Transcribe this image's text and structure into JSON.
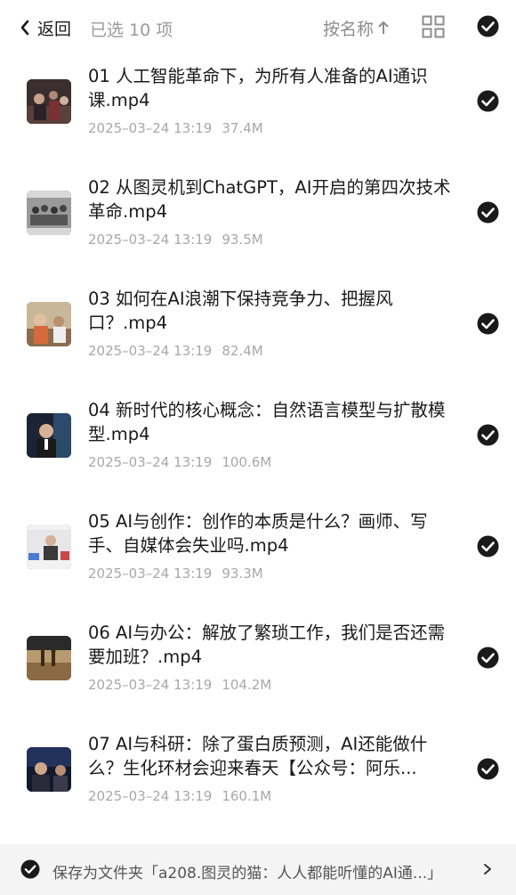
{
  "header": {
    "back_label": "返回",
    "selected_label": "已选 10 项",
    "sort_label": "按名称",
    "sort_icon": "arrow-up-icon",
    "view_icon": "grid-icon",
    "select_all_icon": "check-circle-icon"
  },
  "items": [
    {
      "title": "01 人工智能革命下，为所有人准备的AI通识课.mp4",
      "date": "2025–03–24 13:19",
      "size": "37.4M",
      "selected": true
    },
    {
      "title": "02 从图灵机到ChatGPT，AI开启的第四次技术革命.mp4",
      "date": "2025–03–24 13:19",
      "size": "93.5M",
      "selected": true
    },
    {
      "title": "03 如何在AI浪潮下保持竞争力、把握风口？.mp4",
      "date": "2025–03–24 13:19",
      "size": "82.4M",
      "selected": true
    },
    {
      "title": "04 新时代的核心概念：自然语言模型与扩散模型.mp4",
      "date": "2025–03–24 13:19",
      "size": "100.6M",
      "selected": true
    },
    {
      "title": "05 AI与创作：创作的本质是什么？画师、写手、自媒体会失业吗.mp4",
      "date": "2025–03–24 13:19",
      "size": "93.3M",
      "selected": true
    },
    {
      "title": "06 AI与办公：解放了繁琐工作，我们是否还需要加班？.mp4",
      "date": "2025–03–24 13:19",
      "size": "104.2M",
      "selected": true
    },
    {
      "title": "07 AI与科研：除了蛋白质预测，AI还能做什么？生化环材会迎来春天【公众号：阿乐...",
      "date": "2025–03–24 13:19",
      "size": "160.1M",
      "selected": true
    }
  ],
  "footer": {
    "text": "保存为文件夹「a208.图灵的猫：人人都能听懂的AI通...」",
    "checked": true
  },
  "colors": {
    "check_fill": "#1a1a1a",
    "muted_text": "#a8a8a8",
    "footer_bg": "#f4f4f4"
  }
}
